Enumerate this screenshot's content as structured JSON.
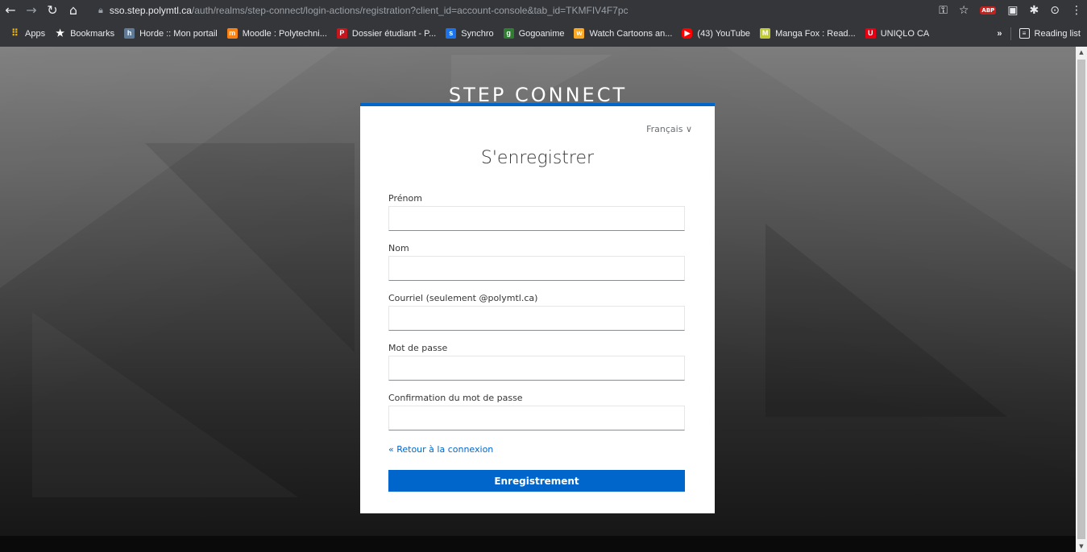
{
  "browser": {
    "url_host": "sso.step.polymtl.ca",
    "url_path": "/auth/realms/step-connect/login-actions/registration?client_id=account-console&tab_id=TKMFIV4F7pc",
    "abp_label": "ABP"
  },
  "bookmarks": {
    "apps": "Apps",
    "bookmarks": "Bookmarks",
    "items": [
      "Horde :: Mon portail",
      "Moodle : Polytechni...",
      "Dossier étudiant - P...",
      "Synchro",
      "Gogoanime",
      "Watch Cartoons an...",
      "(43) YouTube",
      "Manga Fox : Read...",
      "UNIQLO CA"
    ],
    "overflow": "»",
    "reading_list": "Reading list"
  },
  "page": {
    "brand": "STEP CONNECT",
    "language": "Français ∨",
    "title": "S'enregistrer",
    "fields": {
      "first_name": "Prénom",
      "last_name": "Nom",
      "email": "Courriel (seulement @polymtl.ca)",
      "password": "Mot de passe",
      "password_confirm": "Confirmation du mot de passe"
    },
    "back_link": "« Retour à la connexion",
    "submit": "Enregistrement"
  },
  "colors": {
    "accent": "#0066cc",
    "browser_chrome": "#35363a"
  }
}
